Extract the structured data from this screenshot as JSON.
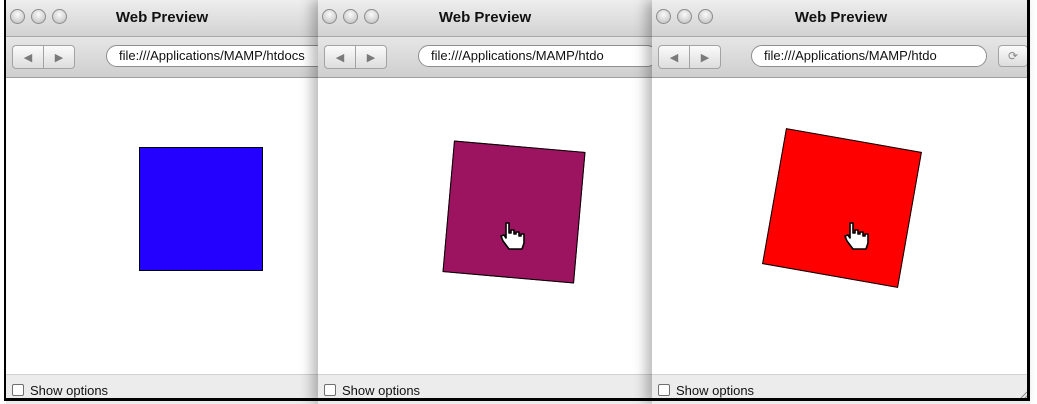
{
  "windows": [
    {
      "title": "Web Preview",
      "url": "file:///Applications/MAMP/htdocs",
      "back_icon": "◀",
      "forward_icon": "▶",
      "square_color": "#2300ff",
      "show_options_label": "Show options",
      "show_options_checked": false
    },
    {
      "title": "Web Preview",
      "url": "file:///Applications/MAMP/htdo",
      "back_icon": "◀",
      "forward_icon": "▶",
      "square_color": "#9c1460",
      "show_options_label": "Show options",
      "show_options_checked": false
    },
    {
      "title": "Web Preview",
      "url": "file:///Applications/MAMP/htdo",
      "back_icon": "◀",
      "forward_icon": "▶",
      "reload_icon": "⟳",
      "square_color": "#ff0000",
      "show_options_label": "Show options",
      "show_options_checked": false
    }
  ]
}
